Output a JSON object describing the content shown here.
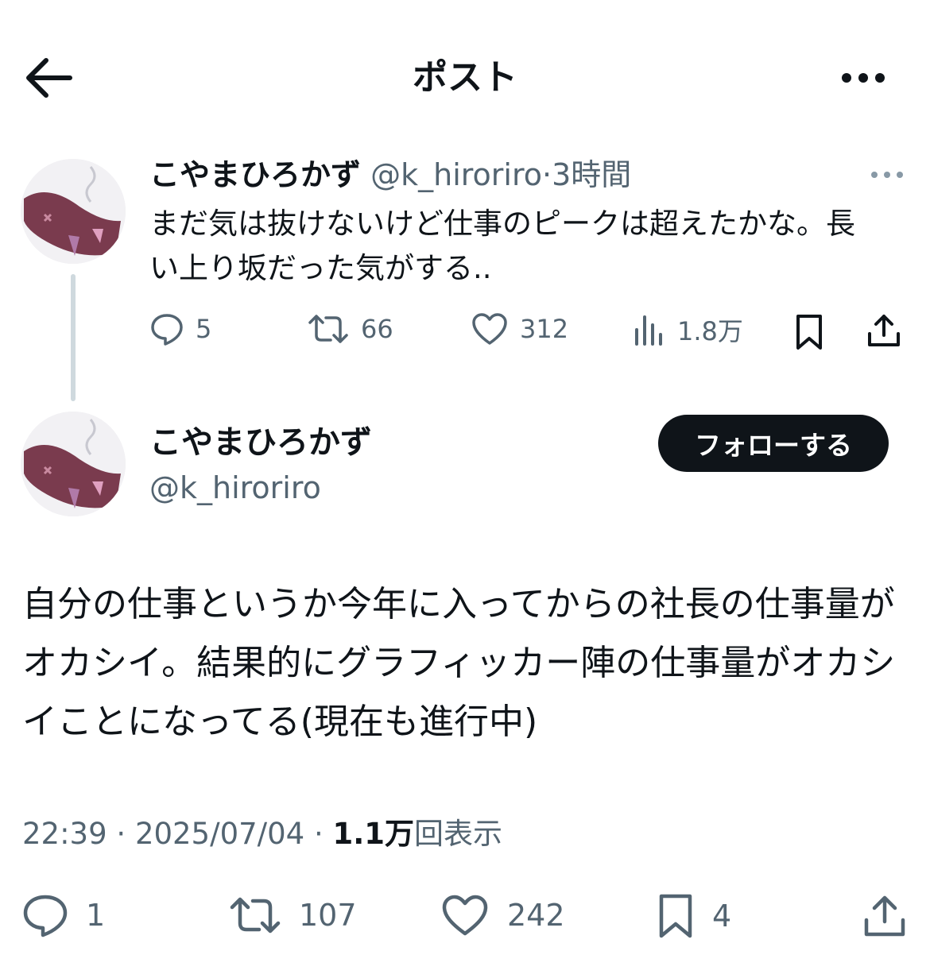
{
  "header": {
    "title": "ポスト",
    "back_icon": "arrow-left-icon",
    "more_icon": "more-horizontal-icon"
  },
  "reply_to": {
    "display_name": "こやまひろかず",
    "handle": "@k_hiroriro",
    "separator": "·",
    "time_ago": "3時間",
    "text": "まだ気は抜けないけど仕事のピークは超えたかな。長い上り坂だった気がする..",
    "stats": {
      "replies": "5",
      "reposts": "66",
      "likes": "312",
      "views": "1.8万"
    }
  },
  "post": {
    "display_name": "こやまひろかず",
    "handle": "@k_hiroriro",
    "follow_label": "フォローする",
    "text": "自分の仕事というか今年に入ってからの社長の仕事量がオカシイ。結果的にグラフィッカー陣の仕事量がオカシイことになってる(現在も進行中)",
    "time": "22:39",
    "date": "2025/07/04",
    "sep": "·",
    "views_count": "1.1万",
    "views_label": "回表示",
    "stats": {
      "replies": "1",
      "reposts": "107",
      "likes": "242",
      "bookmarks": "4"
    }
  },
  "colors": {
    "text": "#0f1419",
    "secondary": "#536471",
    "follow_bg": "#0f1419",
    "thread_line": "#cfd9de"
  }
}
